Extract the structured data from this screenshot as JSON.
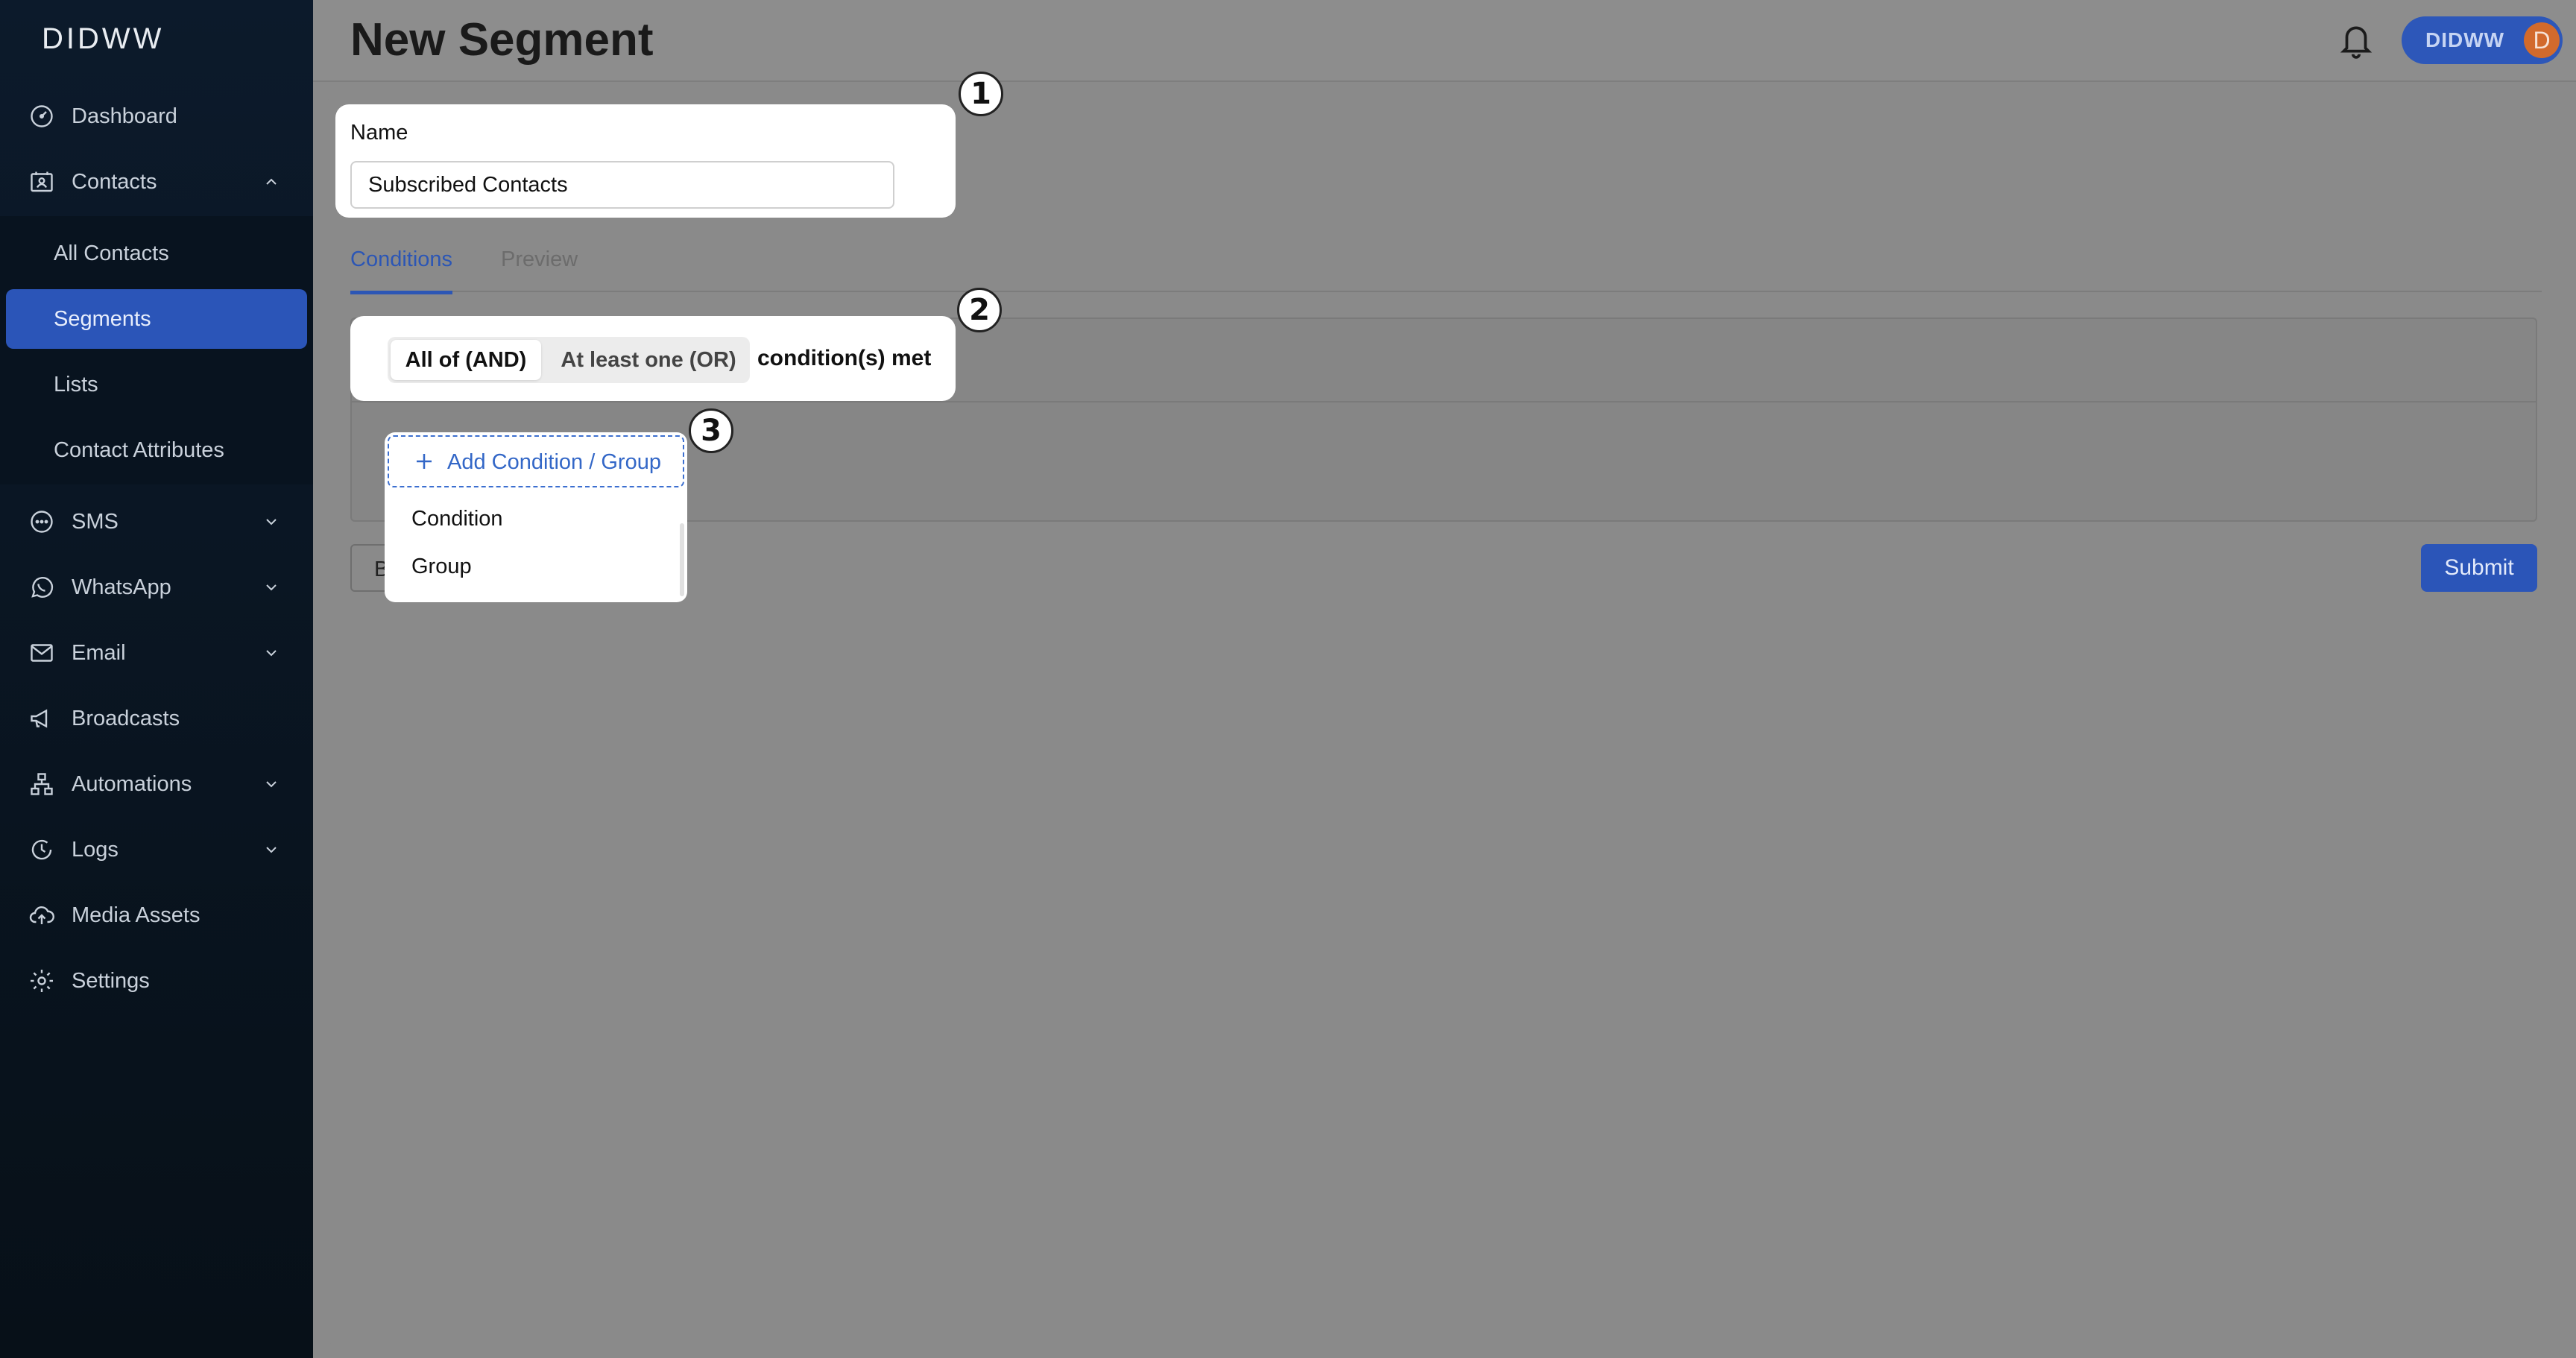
{
  "brand": {
    "logo_text": "DIDWW"
  },
  "sidebar": {
    "items": [
      {
        "label": "Dashboard",
        "icon": "dashboard-icon"
      },
      {
        "label": "Contacts",
        "icon": "contacts-icon",
        "expanded": true
      },
      {
        "label": "SMS",
        "icon": "sms-icon"
      },
      {
        "label": "WhatsApp",
        "icon": "whatsapp-icon"
      },
      {
        "label": "Email",
        "icon": "email-icon"
      },
      {
        "label": "Broadcasts",
        "icon": "megaphone-icon"
      },
      {
        "label": "Automations",
        "icon": "automations-icon"
      },
      {
        "label": "Logs",
        "icon": "logs-icon"
      },
      {
        "label": "Media Assets",
        "icon": "cloud-upload-icon"
      },
      {
        "label": "Settings",
        "icon": "gear-icon"
      }
    ],
    "contacts_submenu": [
      {
        "label": "All Contacts"
      },
      {
        "label": "Segments",
        "active": true
      },
      {
        "label": "Lists"
      },
      {
        "label": "Contact Attributes"
      }
    ]
  },
  "header": {
    "title": "New Segment",
    "user": {
      "name": "DIDWW",
      "avatar_initial": "D"
    }
  },
  "form": {
    "name_label": "Name",
    "name_value": "Subscribed Contacts"
  },
  "tabs": [
    {
      "label": "Conditions",
      "active": true
    },
    {
      "label": "Preview",
      "active": false
    }
  ],
  "conditions": {
    "logic_options": [
      "All of (AND)",
      "At least one (OR)"
    ],
    "selected": "All of (AND)",
    "suffix": "condition(s) met",
    "add_button_label": "Add Condition / Group",
    "menu_options": [
      "Condition",
      "Group"
    ]
  },
  "actions": {
    "back_label": "B",
    "submit_label": "Submit"
  },
  "callouts": [
    "1",
    "2",
    "3"
  ],
  "colors": {
    "sidebar_bg": "#0c1a2b",
    "accent": "#2b55b8",
    "overlay": "#8a8a8a"
  }
}
